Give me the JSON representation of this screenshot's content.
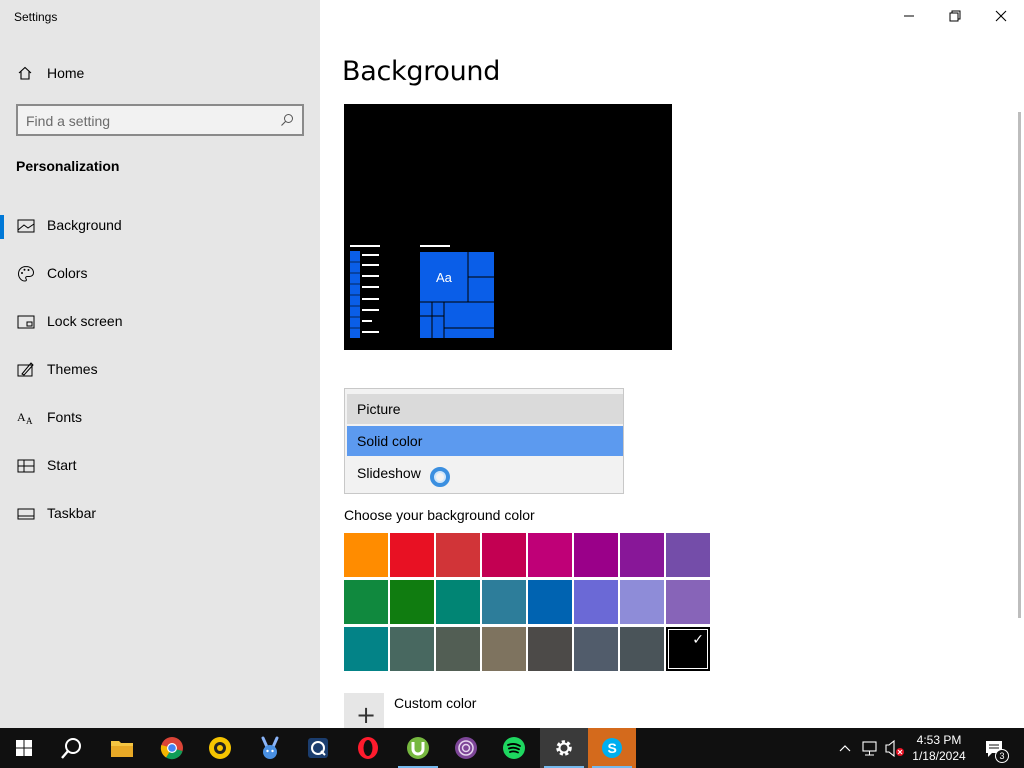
{
  "window": {
    "title": "Settings",
    "controls": [
      "minimize",
      "restore",
      "close"
    ]
  },
  "sidebar": {
    "home_label": "Home",
    "search_placeholder": "Find a setting",
    "section_title": "Personalization",
    "items": [
      {
        "label": "Background",
        "icon": "picture-icon",
        "active": true
      },
      {
        "label": "Colors",
        "icon": "palette-icon",
        "active": false
      },
      {
        "label": "Lock screen",
        "icon": "lock-screen-icon",
        "active": false
      },
      {
        "label": "Themes",
        "icon": "themes-icon",
        "active": false
      },
      {
        "label": "Fonts",
        "icon": "fonts-icon",
        "active": false
      },
      {
        "label": "Start",
        "icon": "start-icon",
        "active": false
      },
      {
        "label": "Taskbar",
        "icon": "taskbar-icon",
        "active": false
      }
    ]
  },
  "main": {
    "title": "Background",
    "preview_tile_text": "Aa",
    "dropdown": {
      "options": [
        "Picture",
        "Solid color",
        "Slideshow"
      ],
      "selected": "Solid color",
      "hovered": "Picture"
    },
    "choose_label": "Choose your background color",
    "colors": [
      "#ff8c00",
      "#e81123",
      "#d13438",
      "#c30052",
      "#bf0077",
      "#9a0089",
      "#881798",
      "#744da9",
      "#10893e",
      "#107c10",
      "#018574",
      "#2d7d9a",
      "#0063b1",
      "#6b69d6",
      "#8e8cd8",
      "#8764b8",
      "#038387",
      "#486860",
      "#525e54",
      "#7e735f",
      "#4c4a48",
      "#515c6b",
      "#4a5459",
      "#000000"
    ],
    "selected_color_index": 23,
    "custom_color_label": "Custom color",
    "accent_color": "#0078d7"
  },
  "taskbar": {
    "apps": [
      "start-icon",
      "search-icon",
      "file-explorer-icon",
      "chrome-icon",
      "norton-icon",
      "bunny-icon",
      "qbittorrent-icon",
      "opera-icon",
      "utorrent-icon",
      "tor-icon",
      "spotify-icon",
      "settings-icon",
      "skype-icon"
    ],
    "time": "4:53 PM",
    "date": "1/18/2024",
    "notification_count": "3"
  }
}
